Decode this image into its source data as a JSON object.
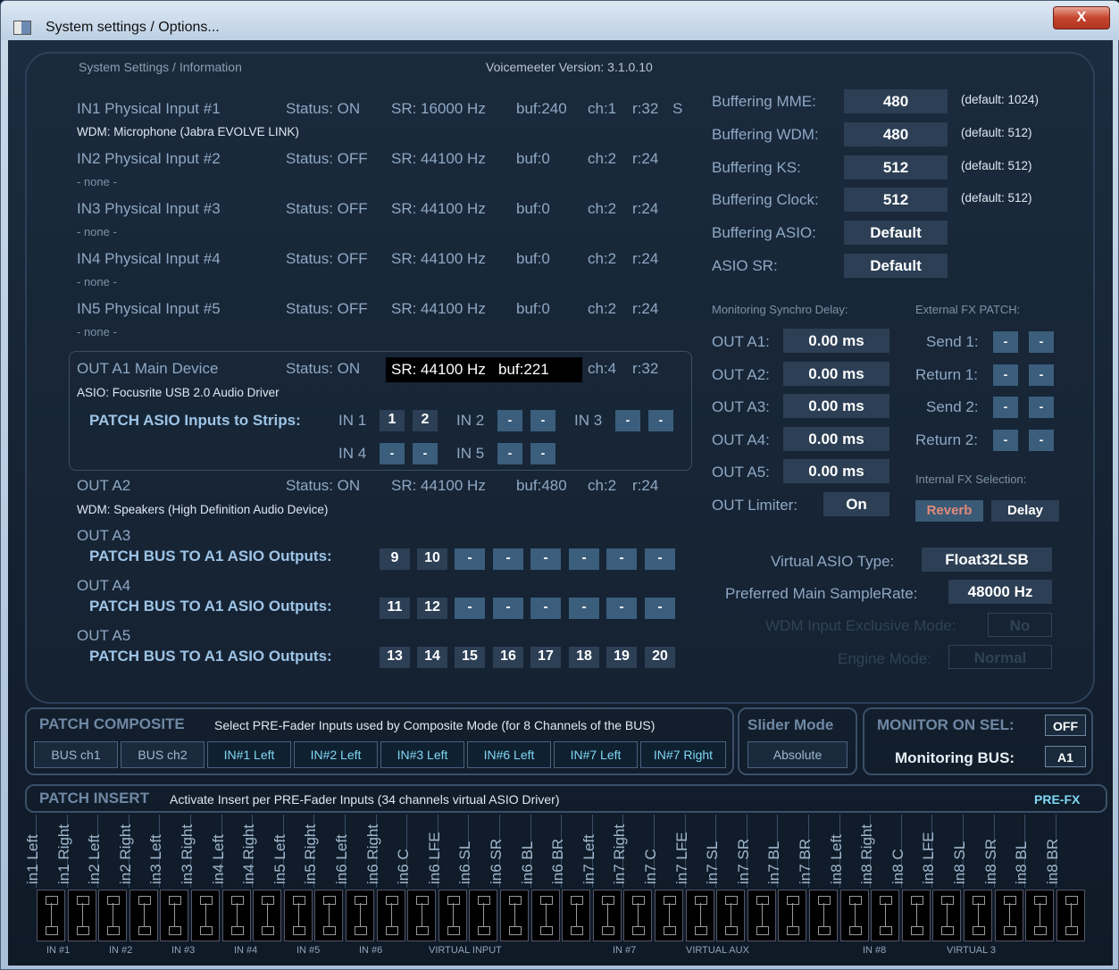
{
  "window": {
    "title": "System settings / Options...",
    "close_label": "X"
  },
  "header": {
    "left": "System Settings / Information",
    "version": "Voicemeeter Version: 3.1.0.10"
  },
  "inputs": [
    {
      "name": "IN1 Physical Input #1",
      "status": "Status: ON",
      "sr": "SR: 16000 Hz",
      "buf": "buf:240",
      "ch": "ch:1",
      "r": "r:32",
      "extra": "S",
      "device": "WDM: Microphone (Jabra EVOLVE LINK)"
    },
    {
      "name": "IN2 Physical Input #2",
      "status": "Status: OFF",
      "sr": "SR: 44100 Hz",
      "buf": "buf:0",
      "ch": "ch:2",
      "r": "r:24",
      "extra": "",
      "device": "- none -"
    },
    {
      "name": "IN3 Physical Input #3",
      "status": "Status: OFF",
      "sr": "SR: 44100 Hz",
      "buf": "buf:0",
      "ch": "ch:2",
      "r": "r:24",
      "extra": "",
      "device": "- none -"
    },
    {
      "name": "IN4 Physical Input #4",
      "status": "Status: OFF",
      "sr": "SR: 44100 Hz",
      "buf": "buf:0",
      "ch": "ch:2",
      "r": "r:24",
      "extra": "",
      "device": "- none -"
    },
    {
      "name": "IN5 Physical Input #5",
      "status": "Status: OFF",
      "sr": "SR: 44100 Hz",
      "buf": "buf:0",
      "ch": "ch:2",
      "r": "r:24",
      "extra": "",
      "device": "- none -"
    }
  ],
  "outa1": {
    "name": "OUT A1 Main Device",
    "status": "Status: ON",
    "sr": "SR: 44100 Hz",
    "buf": "buf:221",
    "ch": "ch:4",
    "r": "r:32",
    "device": "ASIO: Focusrite USB 2.0 Audio Driver",
    "patch_label": "PATCH ASIO Inputs to Strips:",
    "in1": "IN 1",
    "in2": "IN 2",
    "in3": "IN 3",
    "in4": "IN 4",
    "in5": "IN 5",
    "in1_a": "1",
    "in1_b": "2",
    "dash": "-"
  },
  "outa2": {
    "name": "OUT A2",
    "status": "Status: ON",
    "sr": "SR: 44100 Hz",
    "buf": "buf:480",
    "ch": "ch:2",
    "r": "r:24",
    "device": "WDM: Speakers (High Definition Audio Device)"
  },
  "outa3": {
    "name": "OUT A3",
    "patch": "PATCH BUS TO A1 ASIO Outputs:",
    "vals": [
      "9",
      "10",
      "-",
      "-",
      "-",
      "-",
      "-",
      "-"
    ]
  },
  "outa4": {
    "name": "OUT A4",
    "patch": "PATCH BUS TO A1 ASIO Outputs:",
    "vals": [
      "11",
      "12",
      "-",
      "-",
      "-",
      "-",
      "-",
      "-"
    ]
  },
  "outa5": {
    "name": "OUT A5",
    "patch": "PATCH BUS TO A1 ASIO Outputs:",
    "vals": [
      "13",
      "14",
      "15",
      "16",
      "17",
      "18",
      "19",
      "20"
    ]
  },
  "buffering": [
    {
      "label": "Buffering MME:",
      "value": "480",
      "def": "(default: 1024)"
    },
    {
      "label": "Buffering WDM:",
      "value": "480",
      "def": "(default: 512)"
    },
    {
      "label": "Buffering KS:",
      "value": "512",
      "def": "(default: 512)"
    },
    {
      "label": "Buffering Clock:",
      "value": "512",
      "def": "(default: 512)"
    },
    {
      "label": "Buffering ASIO:",
      "value": "Default",
      "def": ""
    },
    {
      "label": "ASIO SR:",
      "value": "Default",
      "def": ""
    }
  ],
  "monitoring": {
    "title": "Monitoring Synchro Delay:",
    "rows": [
      {
        "label": "OUT A1:",
        "value": "0.00 ms"
      },
      {
        "label": "OUT A2:",
        "value": "0.00 ms"
      },
      {
        "label": "OUT A3:",
        "value": "0.00 ms"
      },
      {
        "label": "OUT A4:",
        "value": "0.00 ms"
      },
      {
        "label": "OUT A5:",
        "value": "0.00 ms"
      }
    ],
    "limiter_label": "OUT Limiter:",
    "limiter_value": "On"
  },
  "fxpatch": {
    "title": "External FX PATCH:",
    "rows": [
      "Send 1:",
      "Return 1:",
      "Send 2:",
      "Return 2:"
    ],
    "dash": "-",
    "internal_title": "Internal FX Selection:",
    "reverb": "Reverb",
    "delay": "Delay"
  },
  "asio": {
    "type_label": "Virtual ASIO Type:",
    "type_value": "Float32LSB",
    "sr_label": "Preferred Main SampleRate:",
    "sr_value": "48000 Hz",
    "wdm_label": "WDM Input Exclusive Mode:",
    "wdm_value": "No",
    "engine_label": "Engine Mode:",
    "engine_value": "Normal"
  },
  "composite": {
    "title": "PATCH COMPOSITE",
    "desc": "Select PRE-Fader Inputs used by Composite Mode (for 8 Channels of the BUS)",
    "buttons": [
      "BUS ch1",
      "BUS ch2",
      "IN#1 Left",
      "IN#2 Left",
      "IN#3 Left",
      "IN#6 Left",
      "IN#7 Left",
      "IN#7 Right"
    ]
  },
  "slider": {
    "title": "Slider Mode",
    "value": "Absolute"
  },
  "monitor": {
    "title": "MONITOR ON SEL:",
    "value": "OFF",
    "bus_label": "Monitoring BUS:",
    "bus_value": "A1"
  },
  "insert": {
    "title": "PATCH INSERT",
    "desc": "Activate Insert per PRE-Fader Inputs (34 channels virtual ASIO Driver)",
    "mode": "PRE-FX",
    "channels": [
      "in1 Left",
      "in1 Right",
      "in2 Left",
      "in2 Right",
      "in3 Left",
      "in3 Right",
      "in4 Left",
      "in4 Right",
      "in5 Left",
      "in5 Right",
      "in6 Left",
      "in6 Right",
      "in6 C",
      "in6 LFE",
      "in6 SL",
      "in6 SR",
      "in6 BL",
      "in6 BR",
      "in7 Left",
      "in7 Right",
      "in7 C",
      "in7 LFE",
      "in7 SL",
      "in7 SR",
      "in7 BL",
      "in7 BR",
      "in8 Left",
      "in8 Right",
      "in8 C",
      "in8 LFE",
      "in8 SL",
      "in8 SR",
      "in8 BL",
      "in8 BR"
    ],
    "groups": [
      "IN #1",
      "IN #2",
      "IN #3",
      "IN #4",
      "IN #5",
      "IN #6",
      "VIRTUAL INPUT",
      "IN #7",
      "VIRTUAL AUX",
      "IN #8",
      "VIRTUAL 3"
    ]
  }
}
